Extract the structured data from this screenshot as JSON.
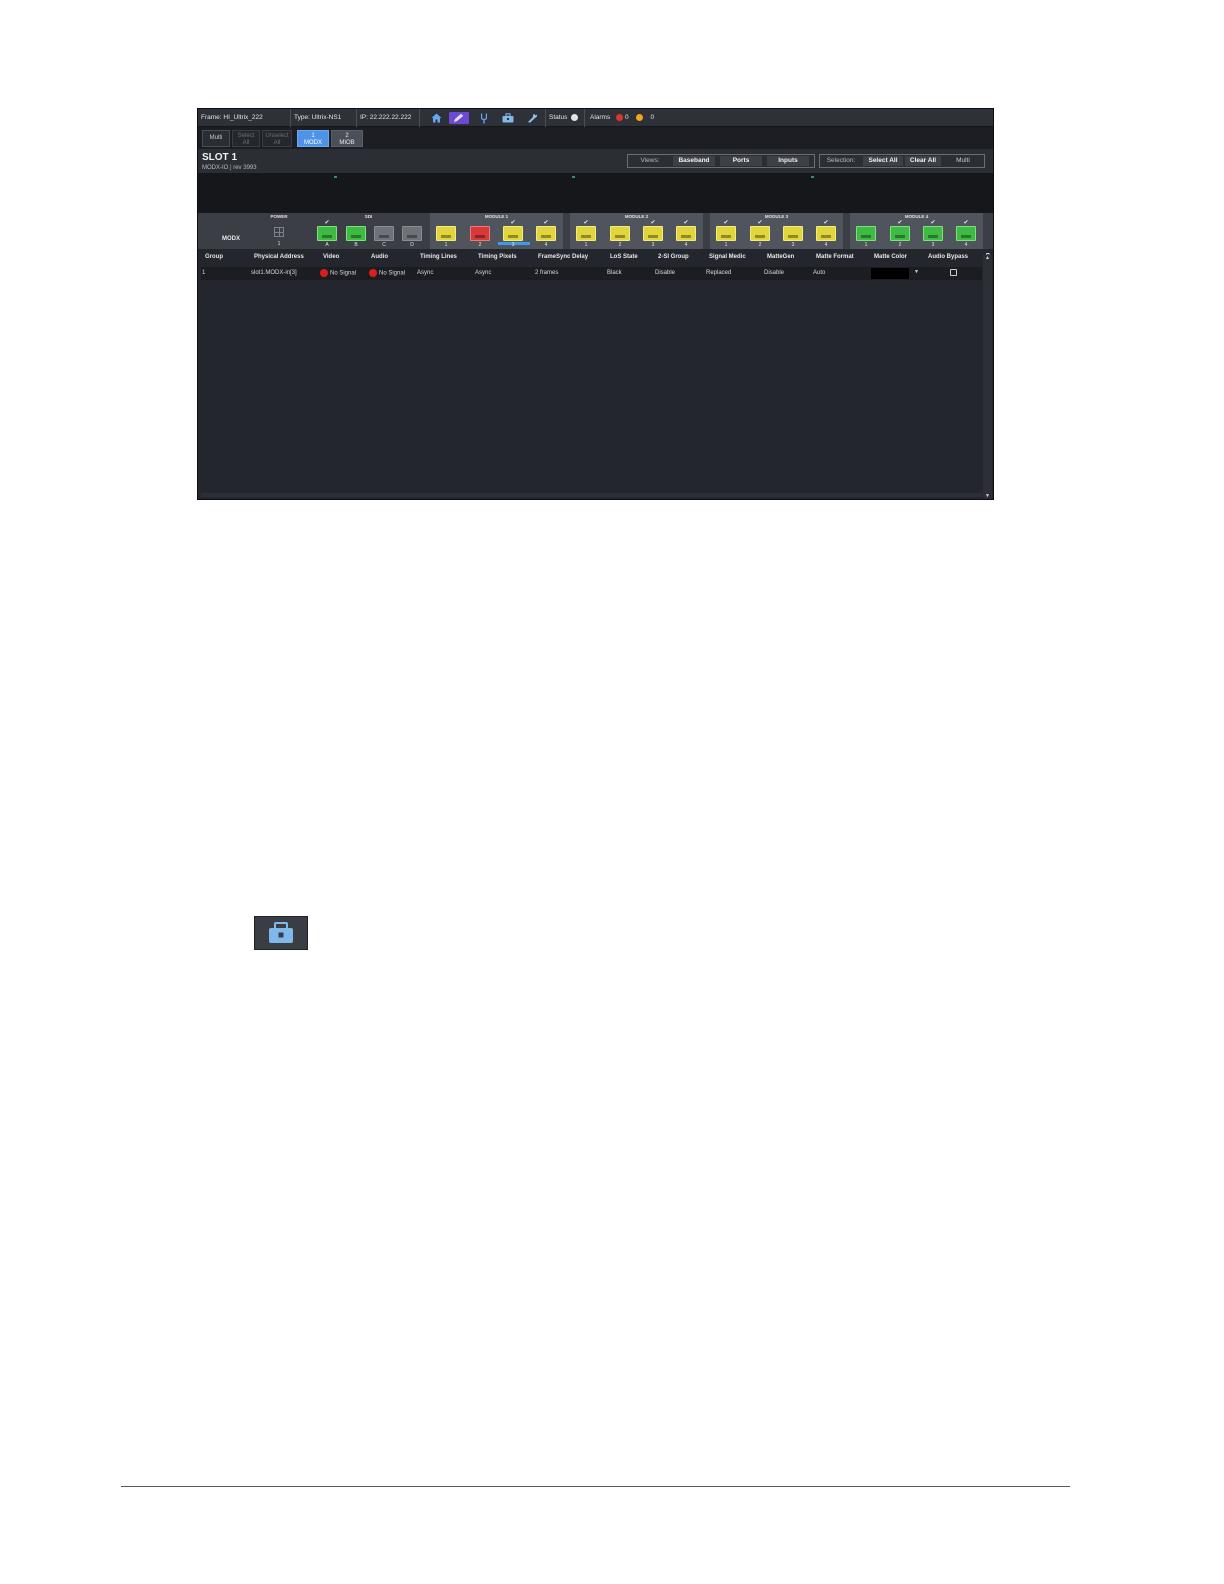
{
  "topbar": {
    "frame": "Frame: HI_Ultrix_222",
    "type": "Type: Ultrix-NS1",
    "ip": "IP: 22.222.22.222",
    "status": "Status",
    "alarms": "Alarms",
    "alarm_red_count": "0",
    "alarm_yellow_count": "0",
    "icons": [
      "home-icon",
      "pencil-icon",
      "tuning-fork-icon",
      "toolbox-icon",
      "wrench-icon"
    ],
    "colors": {
      "active_icon_bg": "#6a4ad6",
      "alarm_red": "#e0342a",
      "alarm_yellow": "#f0a818"
    }
  },
  "toolbar": {
    "multi": "Multi",
    "select_all_1": "Select",
    "select_all_2": "All",
    "unselect_all_1": "Unselect",
    "unselect_all_2": "All",
    "tab1_num": "1",
    "tab1_name": "MODX",
    "tab2_num": "2",
    "tab2_name": "MIOB"
  },
  "slot": {
    "title": "SLOT 1",
    "subtitle": "MODX-IO | rev 3993",
    "views_label": "Views:",
    "views": [
      "Baseband",
      "Ports",
      "Inputs"
    ],
    "selection_label": "Selection:",
    "selection": [
      "Select All",
      "Clear All",
      "Multi"
    ]
  },
  "modules": {
    "card_label": "MODX",
    "groups": [
      {
        "name": "POWER",
        "ports": [
          "1"
        ]
      },
      {
        "name": "SDI",
        "ports": [
          "A",
          "B",
          "C",
          "D"
        ],
        "colors": [
          "green",
          "green",
          "grey",
          "grey"
        ]
      },
      {
        "name": "MODULE 1",
        "ports": [
          "1",
          "2",
          "3",
          "4"
        ],
        "colors": [
          "yellow",
          "red",
          "yellow",
          "yellow"
        ]
      },
      {
        "name": "MODULE 2",
        "ports": [
          "1",
          "2",
          "3",
          "4"
        ],
        "colors": [
          "yellow",
          "yellow",
          "yellow",
          "yellow"
        ]
      },
      {
        "name": "MODULE 3",
        "ports": [
          "1",
          "2",
          "3",
          "4"
        ],
        "colors": [
          "yellow",
          "yellow",
          "yellow",
          "yellow"
        ]
      },
      {
        "name": "MODULE 4",
        "ports": [
          "1",
          "2",
          "3",
          "4"
        ],
        "colors": [
          "green",
          "green",
          "green",
          "green"
        ]
      }
    ],
    "check": "✔"
  },
  "table": {
    "headers": [
      "Group",
      "Physical Address",
      "Video",
      "Audio",
      "Timing Lines",
      "Timing Pixels",
      "FrameSync Delay",
      "LoS State",
      "2-SI Group",
      "Signal Medic",
      "MatteGen",
      "Matte Format",
      "Matte Color",
      "Audio Bypass"
    ],
    "rows": [
      {
        "group": "1",
        "physical_address": "slot1.MODX-in[3]",
        "video": "No Signal",
        "audio": "No Signal",
        "timing_lines": "Async",
        "timing_pixels": "Async",
        "framesync_delay": "2 frames",
        "los_state": "Black",
        "twosi_group": "Disable",
        "signal_medic": "Replaced",
        "mattegen": "Disable",
        "matte_format": "Auto",
        "matte_color": "#000000",
        "audio_bypass": false
      }
    ]
  }
}
